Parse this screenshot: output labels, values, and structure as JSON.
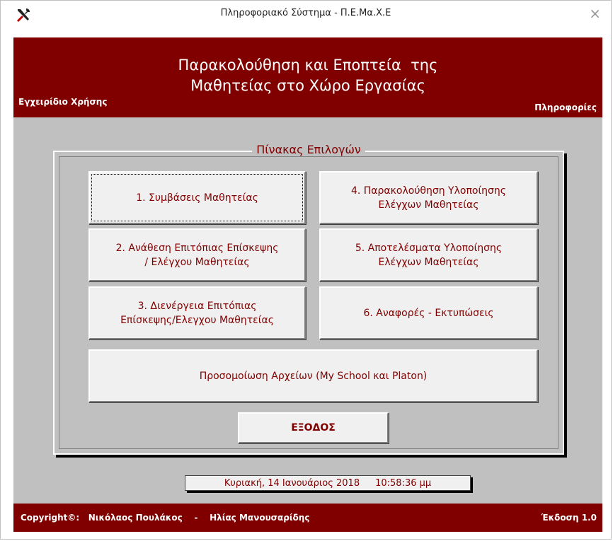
{
  "window": {
    "title": "Πληροφοριακό Σύστημα - Π.Ε.Μα.Χ.Ε",
    "close_glyph": "×",
    "app_icon": "tools-icon"
  },
  "header": {
    "title_line1": "Παρακολούθηση και Εποπτεία  της",
    "title_line2": "Μαθητείας στο Χώρο Εργασίας",
    "manual_link": "Εγχειρίδιο Χρήσης",
    "info_link": "Πληροφορίες",
    "background_color": "#800000"
  },
  "panel": {
    "legend": "Πίνακας Επιλογών"
  },
  "buttons": {
    "b1": "1. Συμβάσεις Μαθητείας",
    "b2_line1": "2. Ανάθεση Επιτόπιας Επίσκεψης",
    "b2_line2": "/ Ελέγχου Μαθητείας",
    "b3_line1": "3. Διενέργεια Επιτόπιας",
    "b3_line2": "Επίσκεψης/Ελεγχου Μαθητείας",
    "b4_line1": "4. Παρακολούθηση Υλοποίησης",
    "b4_line2": "Ελέγχων Μαθητείας",
    "b5_line1": "5. Αποτελέσματα Υλοποίησης",
    "b5_line2": "Ελέγχων Μαθητείας",
    "b6": "6. Αναφορές - Εκτυπώσεις",
    "simulation": "Προσομοίωση Αρχείων (My School και Platon)",
    "exit": "ΕΞΟΔΟΣ"
  },
  "status": {
    "date": "Κυριακή, 14 Ιανουάριος 2018",
    "time": "10:58:36 μμ"
  },
  "footer": {
    "copyright_label": "Copyright©:",
    "author1": "Νικόλαος Πουλάκος",
    "separator": "-",
    "author2": "Ηλίας Μανουσαρίδης",
    "version": "Έκδοση 1.0"
  },
  "colors": {
    "accent": "#800000",
    "background": "#c0c0c0",
    "button_face": "#f0f0f0"
  }
}
